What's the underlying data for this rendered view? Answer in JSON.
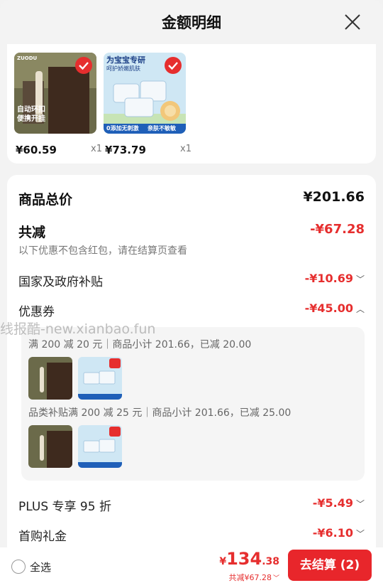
{
  "header": {
    "title": "金额明细"
  },
  "products": [
    {
      "thumb_text": "自动环扣\n便携开挂",
      "brand": "ZUODU",
      "price": "¥60.59",
      "qty": "x1"
    },
    {
      "thumb_banner": "为宝宝专研",
      "thumb_sub": "呵护娇嫩肌肤",
      "thumb_footer_left": "0添加无刺激",
      "thumb_footer_right": "亲肤不敏敏",
      "price": "¥73.79",
      "qty": "x1"
    }
  ],
  "summary": {
    "goods_total_label": "商品总价",
    "goods_total_value": "¥201.66",
    "reduce_label": "共减",
    "reduce_value": "-¥67.28",
    "reduce_note": "以下优惠不包含红包，请在结算页查看",
    "subsidy_label": "国家及政府补贴",
    "subsidy_value": "-¥10.69",
    "coupon_label": "优惠券",
    "coupon_value": "-¥45.00",
    "coupon_lines": [
      "满 200 减 20 元｜商品小计 201.66，已减 20.00",
      "品类补贴满 200 减 25 元｜商品小计 201.66，已减 25.00"
    ],
    "plus_label": "PLUS 专享 95 折",
    "plus_value": "-¥5.49",
    "first_label": "首购礼金",
    "first_value": "-¥6.10"
  },
  "watermark": "线报酷-new.xianbao.fun",
  "bottom": {
    "select_all": "全选",
    "yen": "¥",
    "total_int": "134",
    "total_dec": ".38",
    "saving": "共减¥67.28",
    "checkout": "去结算 (2)"
  },
  "colors": {
    "accent": "#e62e2e",
    "bg": "#f3f3f3"
  },
  "icons": [
    "close-icon",
    "check-icon",
    "chevron-down-icon",
    "chevron-up-icon"
  ]
}
